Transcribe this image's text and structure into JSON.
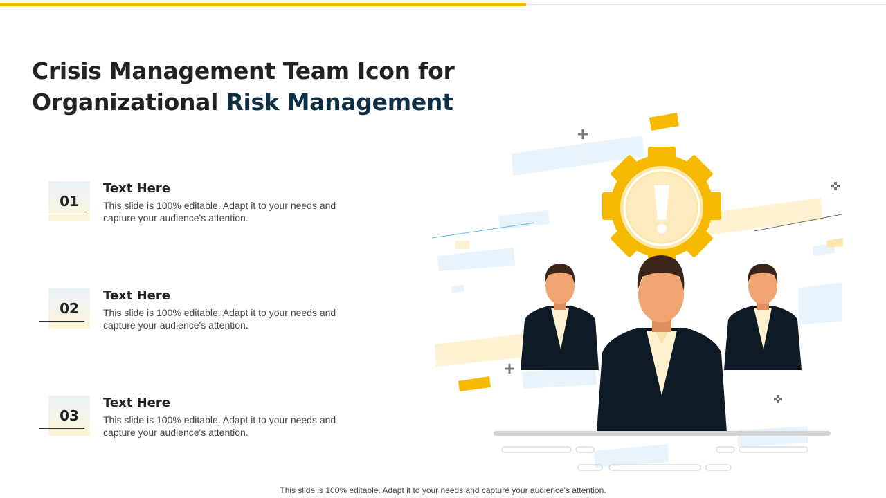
{
  "title": {
    "line1": "Crisis Management Team Icon for",
    "line2_plain": "Organizational",
    "line2_accent": "Risk Management"
  },
  "items": [
    {
      "number": "01",
      "heading": "Text Here",
      "description": "This slide is 100% editable. Adapt it to your needs and capture your audience's attention."
    },
    {
      "number": "02",
      "heading": "Text Here",
      "description": "This slide is 100% editable. Adapt it to your needs and capture your audience's attention."
    },
    {
      "number": "03",
      "heading": "Text Here",
      "description": "This slide is 100% editable. Adapt it to your needs and capture your audience's attention."
    }
  ],
  "footer": "This slide is 100% editable. Adapt it to your needs and capture your audience's attention.",
  "colors": {
    "accent_yellow": "#f5b900",
    "title_dark": "#222222",
    "title_accent": "#0f2f44",
    "suit": "#0e1a25",
    "skin": "#efa472",
    "hair": "#3b2518"
  },
  "icons": [
    "gear-warning-icon",
    "crisis-team-people-icon"
  ]
}
